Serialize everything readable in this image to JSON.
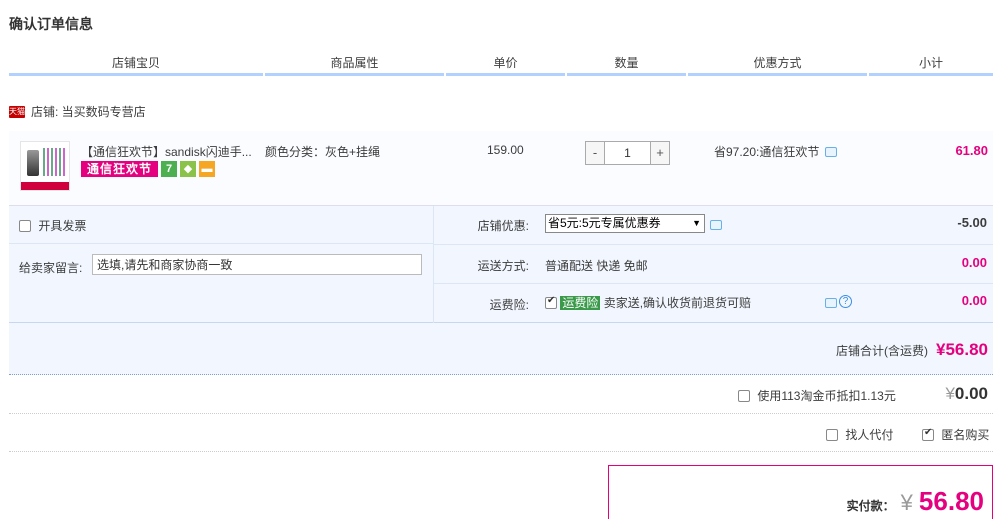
{
  "page_title": "确认订单信息",
  "columns": [
    "店铺宝贝",
    "商品属性",
    "单价",
    "数量",
    "优惠方式",
    "小计"
  ],
  "shop": {
    "badge": "天猫",
    "name": "店铺: 当买数码专营店"
  },
  "item": {
    "name": "【通信狂欢节】sandisk闪迪手...",
    "promo_tag": "通信狂欢节",
    "badge_7": "7",
    "attr": "颜色分类：灰色+挂绳",
    "price": "159.00",
    "quantity": "1",
    "qty_minus": "-",
    "qty_plus": "+",
    "discount": "省97.20:通信狂欢节",
    "subtotal": "61.80"
  },
  "options": {
    "invoice_label": "开具发票",
    "memo_label": "给卖家留言:",
    "memo_placeholder": "选填,请先和商家协商一致",
    "shop_discount_label": "店铺优惠:",
    "shop_discount_value": "省5元:5元专属优惠券",
    "shop_discount_amount": "-5.00",
    "shipping_label": "运送方式:",
    "shipping_value": "普通配送 快递 免邮",
    "shipping_amount": "0.00",
    "insurance_label": "运费险:",
    "insurance_tag": "运费险",
    "insurance_value": "卖家送,确认收货前退货可赔",
    "insurance_amount": "0.00"
  },
  "shop_total": {
    "label": "店铺合计(含运费)",
    "amount": "¥56.80"
  },
  "coin": {
    "label": "使用113淘金币抵扣1.13元",
    "currency": "¥",
    "amount": "0.00"
  },
  "anon": {
    "proxy_label": "找人代付",
    "anonymous_label": "匿名购买"
  },
  "pay": {
    "label": "实付款：",
    "currency": "¥",
    "amount": "56.80"
  },
  "colors": {
    "accent": "#e4007f",
    "header_line": "#b2d1ff",
    "panel_bg": "#f2f7ff"
  }
}
